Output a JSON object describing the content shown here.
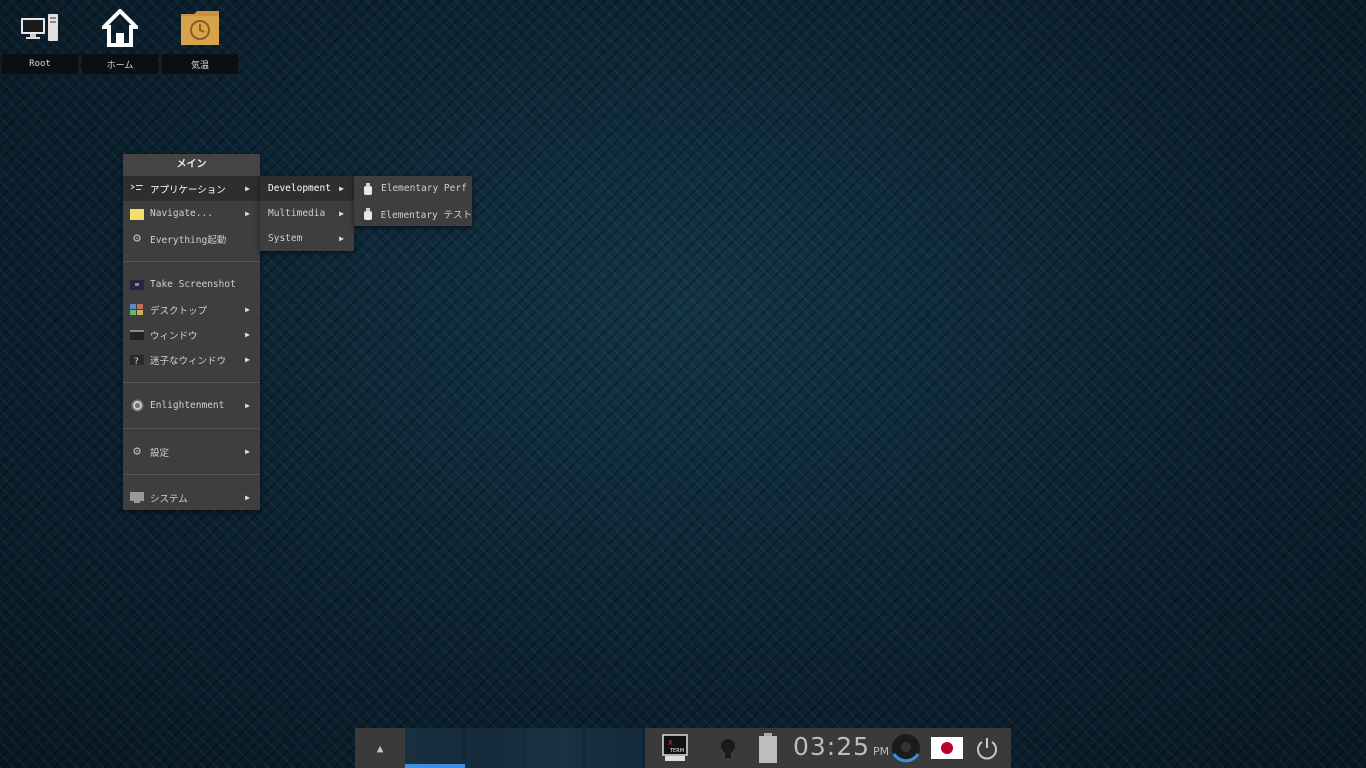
{
  "desktop": {
    "icons": [
      {
        "label": "Root",
        "icon": "computer-icon"
      },
      {
        "label": "ホーム",
        "icon": "home-icon"
      },
      {
        "label": "気温",
        "icon": "clock-folder-icon"
      }
    ]
  },
  "main_menu": {
    "title": "メイン",
    "items": [
      {
        "label": "アプリケーション",
        "icon": "applications-icon",
        "submenu": true,
        "active": true
      },
      {
        "label": "Navigate...",
        "icon": "folder-icon",
        "submenu": true
      },
      {
        "label": "Everything起動",
        "icon": "gear-icon",
        "submenu": false
      },
      {
        "label": "Take Screenshot",
        "icon": "screenshot-icon",
        "submenu": false
      },
      {
        "label": "デスクトップ",
        "icon": "desktop-icon",
        "submenu": true
      },
      {
        "label": "ウィンドウ",
        "icon": "window-icon",
        "submenu": true
      },
      {
        "label": "迷子なウィンドウ",
        "icon": "lost-window-icon",
        "submenu": true
      },
      {
        "label": "Enlightenment",
        "icon": "enlightenment-icon",
        "submenu": true
      },
      {
        "label": "設定",
        "icon": "settings-gear-icon",
        "submenu": true
      },
      {
        "label": "システム",
        "icon": "system-monitor-icon",
        "submenu": true
      }
    ]
  },
  "applications_menu": {
    "items": [
      {
        "label": "Development",
        "active": true
      },
      {
        "label": "Multimedia"
      },
      {
        "label": "System"
      }
    ]
  },
  "development_menu": {
    "items": [
      {
        "label": "Elementary Perf",
        "icon": "elementary-icon"
      },
      {
        "label": "Elementary テスト",
        "icon": "elementary-icon"
      }
    ]
  },
  "taskbar": {
    "clock": {
      "time": "03:25",
      "ampm": "PM"
    },
    "colors": {
      "pager_active": "#3a8fe0",
      "shelf": "#3a3a3a",
      "flag_red": "#bc002d"
    },
    "icons": [
      "up-arrow-icon",
      "xterm-icon",
      "lightbulb-icon",
      "battery-icon",
      "mixer-knob-icon",
      "japan-flag-icon",
      "power-icon"
    ]
  }
}
